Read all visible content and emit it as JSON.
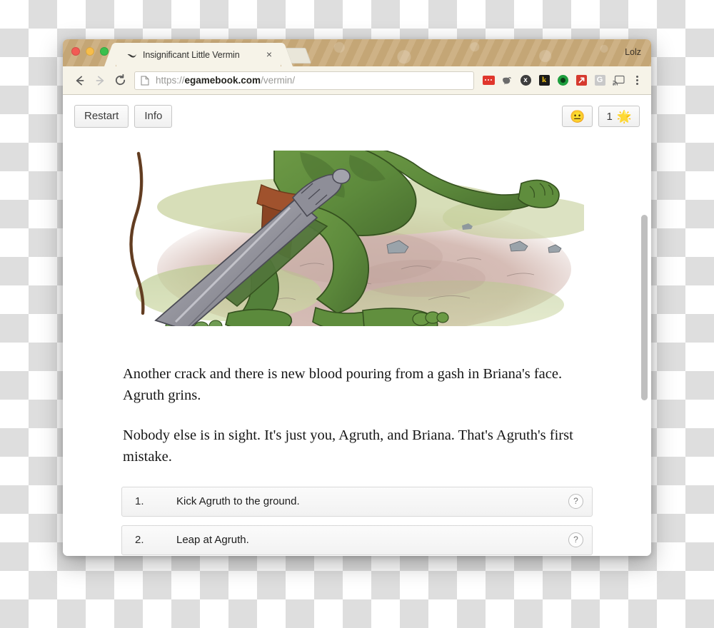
{
  "browser": {
    "traffic_lights": [
      "close",
      "minimize",
      "maximize"
    ],
    "tab": {
      "favicon": "swoosh-icon",
      "title": "Insignificant Little Vermin",
      "close_label": "×"
    },
    "new_tab_label": "+",
    "profile_name": "Lolz",
    "nav": {
      "back": "←",
      "forward": "→",
      "reload": "⟳"
    },
    "omnibox": {
      "page_icon": "document-icon",
      "scheme": "https://",
      "host": "egamebook.com",
      "path": "/vermin/",
      "full_url": "https://egamebook.com/vermin/"
    },
    "extensions": [
      {
        "name": "dots-extension-icon",
        "label": "•••",
        "color": "#e0362c"
      },
      {
        "name": "evernote-elephant-icon",
        "label": "",
        "color": "#6b6b6b"
      },
      {
        "name": "x-circle-extension-icon",
        "label": "x",
        "color": "#3d3d3d"
      },
      {
        "name": "kindle-k-extension-icon",
        "label": "k",
        "color": "#f5c518"
      },
      {
        "name": "green-circle-extension-icon",
        "label": "",
        "color": "#1e9e3e"
      },
      {
        "name": "red-arrow-extension-icon",
        "label": "↗",
        "color": "#d63a2f"
      },
      {
        "name": "google-g-extension-icon",
        "label": "G",
        "color": "#c9c9c9"
      },
      {
        "name": "cast-icon",
        "label": "",
        "color": "#5b5b5b"
      },
      {
        "name": "browser-menu-icon",
        "label": "⋮",
        "color": "#5b5b5b"
      }
    ]
  },
  "app": {
    "toolbar": {
      "restart_label": "Restart",
      "info_label": "Info",
      "mood_emoji": "😐",
      "score_value": "1",
      "score_emoji": "🌟"
    },
    "illustration": {
      "alt": "A large green orc with a massive sword standing over a kneeling woman who shields herself with raised arms on dusty ground"
    },
    "story_paragraphs": [
      "Another crack and there is new blood pouring from a gash in Briana's face. Agruth grins.",
      "Nobody else is in sight. It's just you, Agruth, and Briana. That's Agruth's first mistake."
    ],
    "choices": [
      {
        "number": "1.",
        "label": "Kick Agruth to the ground.",
        "help": "?"
      },
      {
        "number": "2.",
        "label": "Leap at Agruth.",
        "help": "?"
      }
    ]
  }
}
